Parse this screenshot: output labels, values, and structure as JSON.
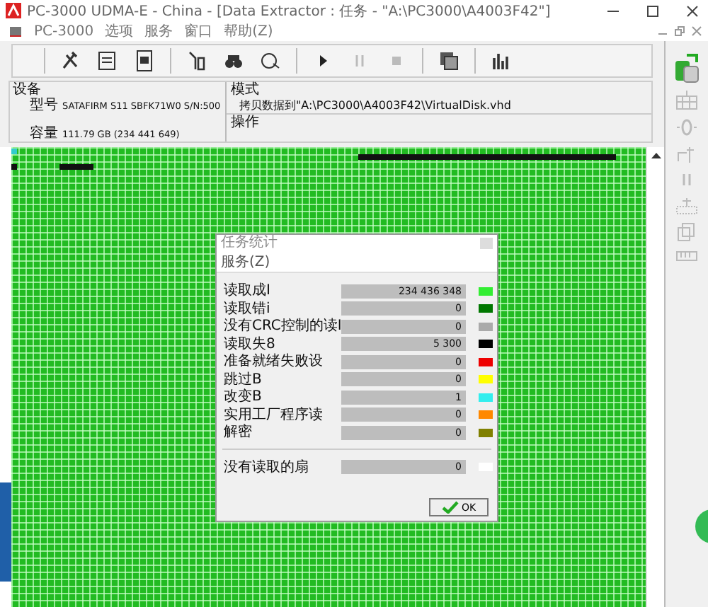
{
  "window": {
    "title": "PC-3000 UDMA-E - China - [Data Extractor : 任务 - \"A:\\PC3000\\A4003F42\"]"
  },
  "menu": [
    "PC-3000",
    "选项",
    "服务",
    "窗口",
    "帮助(Z)"
  ],
  "device": {
    "heading": "设备",
    "model_label": "型号",
    "model": "SATAFIRM   S11 SBFK71W0 S/N:500",
    "capacity_label": "容量",
    "capacity": "111.79 GB (234 441 649)"
  },
  "mode": {
    "heading": "模式",
    "text": "拷贝数据到\"A:\\PC3000\\A4003F42\\VirtualDisk.vhd",
    "operation_heading": "操作"
  },
  "dialog": {
    "title": "任务统计",
    "menu": "服务(Z)",
    "rows": [
      {
        "label": "读取成I",
        "value": "234 436 348",
        "color": "#33ee33"
      },
      {
        "label": "读取错i",
        "value": "0",
        "color": "#007700"
      },
      {
        "label": "没有CRC控制的读I",
        "value": "0",
        "color": "#aaaaaa"
      },
      {
        "label": "读取失8",
        "value": "5 300",
        "color": "#000000"
      },
      {
        "label": "准备就绪失败设",
        "value": "0",
        "color": "#ee0000"
      },
      {
        "label": "跳过B",
        "value": "0",
        "color": "#ffff00"
      },
      {
        "label": "改变B",
        "value": "1",
        "color": "#33eeee"
      },
      {
        "label": "实用工厂程序读",
        "value": "0",
        "color": "#ff8800"
      },
      {
        "label": "解密",
        "value": "0",
        "color": "#808000"
      }
    ],
    "unread": {
      "label": "没有读取的扇",
      "value": "0",
      "color": "#ffffff"
    },
    "ok": "OK"
  }
}
